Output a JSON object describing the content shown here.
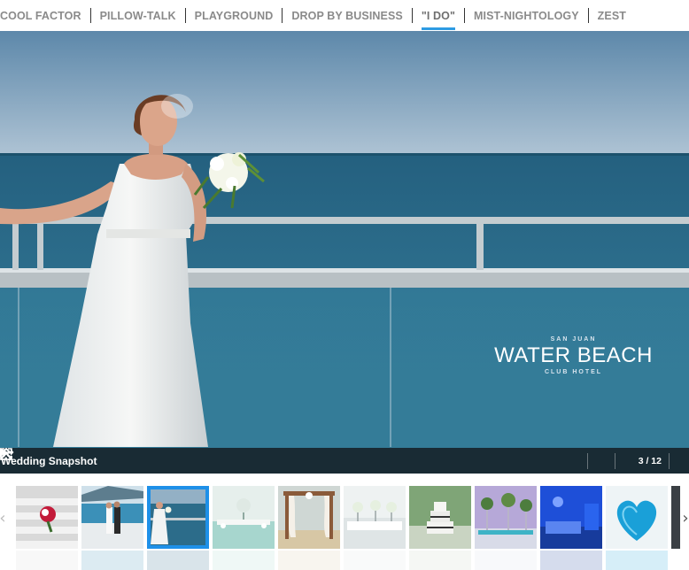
{
  "tabs": [
    {
      "label": "COOL FACTOR",
      "active": false
    },
    {
      "label": "PILLOW-TALK",
      "active": false
    },
    {
      "label": "PLAYGROUND",
      "active": false
    },
    {
      "label": "DROP BY BUSINESS",
      "active": false
    },
    {
      "label": "\"I DO\"",
      "active": true
    },
    {
      "label": "MIST-NIGHTOLOGY",
      "active": false
    },
    {
      "label": "ZEST",
      "active": false
    }
  ],
  "hero": {
    "watermark": {
      "top": "SAN JUAN",
      "main": "WATER BEACH",
      "bottom": "CLUB HOTEL"
    },
    "caption": "Wedding Snapshot",
    "counter": "3 / 12",
    "controls": [
      "collapse-icon",
      "share-icon",
      "play-icon",
      "fullscreen-icon"
    ]
  },
  "filmstrip": {
    "arrows": {
      "left": "‹",
      "right": "›"
    },
    "thumbnails": [
      {
        "name": "bouquet-on-stairs",
        "active": false
      },
      {
        "name": "couple-by-pool",
        "active": false
      },
      {
        "name": "bride-on-balcony",
        "active": true
      },
      {
        "name": "reception-table",
        "active": false
      },
      {
        "name": "beach-canopy",
        "active": false
      },
      {
        "name": "white-dining-setup",
        "active": false
      },
      {
        "name": "wedding-cake",
        "active": false
      },
      {
        "name": "purple-flower-table",
        "active": false
      },
      {
        "name": "blue-lit-room",
        "active": false
      },
      {
        "name": "heart-flower-arrangement",
        "active": false
      }
    ]
  },
  "colors": {
    "accent": "#2d9be3",
    "active_thumb": "#1e90e8",
    "caption_bar": "#141a1e"
  }
}
